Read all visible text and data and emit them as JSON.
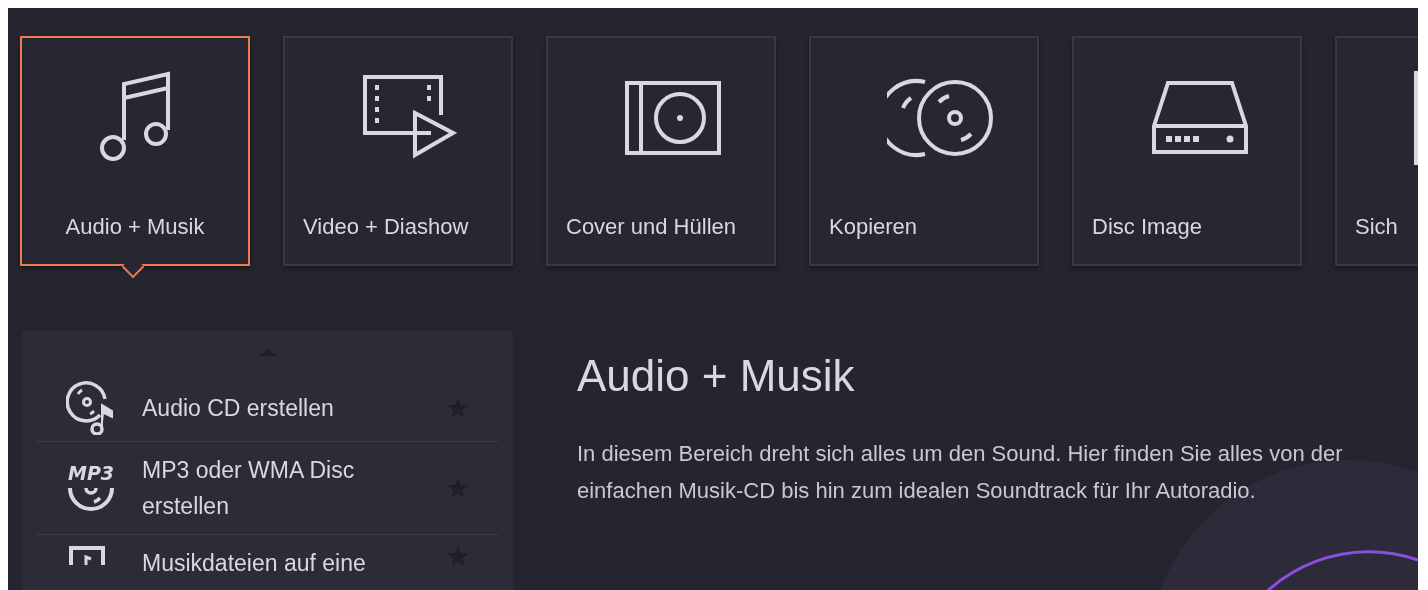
{
  "categories": [
    {
      "label": "Audio + Musik",
      "selected": true
    },
    {
      "label": "Video + Diashow",
      "selected": false
    },
    {
      "label": "Cover und Hüllen",
      "selected": false
    },
    {
      "label": "Kopieren",
      "selected": false
    },
    {
      "label": "Disc Image",
      "selected": false
    },
    {
      "label": "Sich",
      "selected": false
    }
  ],
  "task_list": {
    "items": [
      {
        "label": "Audio CD erstellen",
        "favorite": false
      },
      {
        "label": "MP3 oder WMA Disc erstellen",
        "icon_text": "MP3",
        "favorite": false
      },
      {
        "label": "Musikdateien auf eine",
        "favorite": false
      }
    ]
  },
  "content": {
    "title": "Audio + Musik",
    "description": "In diesem Bereich dreht sich alles um den Sound. Hier finden Sie alles von der einfachen Musik-CD bis hin zum idealen Soundtrack für Ihr Autoradio."
  }
}
